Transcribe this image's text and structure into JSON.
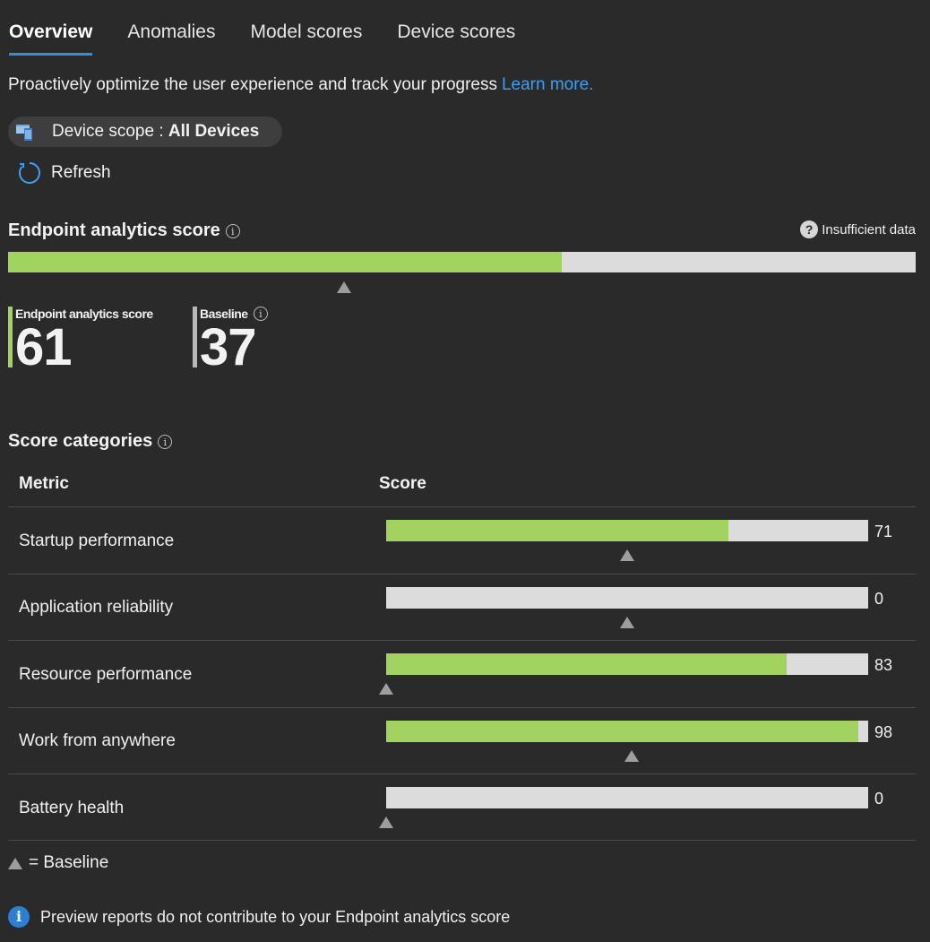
{
  "tabs": [
    {
      "label": "Overview",
      "active": true
    },
    {
      "label": "Anomalies",
      "active": false
    },
    {
      "label": "Model scores",
      "active": false
    },
    {
      "label": "Device scores",
      "active": false
    }
  ],
  "intro": {
    "text": "Proactively optimize the user experience and track your progress",
    "link": "Learn more."
  },
  "scope": {
    "prefix": "Device scope :",
    "value": "All Devices",
    "icon": "devices-icon"
  },
  "refresh": {
    "label": "Refresh",
    "icon": "refresh-icon"
  },
  "score": {
    "title": "Endpoint analytics score",
    "insufficient": "Insufficient data",
    "value_label": "Endpoint analytics score",
    "value": "61",
    "baseline_label": "Baseline",
    "baseline": "37",
    "fill_fraction": 0.61,
    "baseline_fraction": 0.37
  },
  "categories": {
    "title": "Score categories",
    "col_metric": "Metric",
    "col_score": "Score",
    "rows": [
      {
        "metric": "Startup performance",
        "score": "71",
        "fill": 0.71,
        "baseline": 0.5
      },
      {
        "metric": "Application reliability",
        "score": "0",
        "fill": 0.0,
        "baseline": 0.5
      },
      {
        "metric": "Resource performance",
        "score": "83",
        "fill": 0.83,
        "baseline": 0.0
      },
      {
        "metric": "Work from anywhere",
        "score": "98",
        "fill": 0.98,
        "baseline": 0.51
      },
      {
        "metric": "Battery health",
        "score": "0",
        "fill": 0.0,
        "baseline": 0.0
      }
    ]
  },
  "legend": {
    "text": "= Baseline"
  },
  "note": {
    "text": "Preview reports do not contribute to your Endpoint analytics score"
  },
  "colors": {
    "accent": "#2f8ee0",
    "fill": "#a3d35f",
    "track": "#dcdcdc",
    "baseline": "#9e9e9e",
    "link": "#3aa0f3"
  }
}
